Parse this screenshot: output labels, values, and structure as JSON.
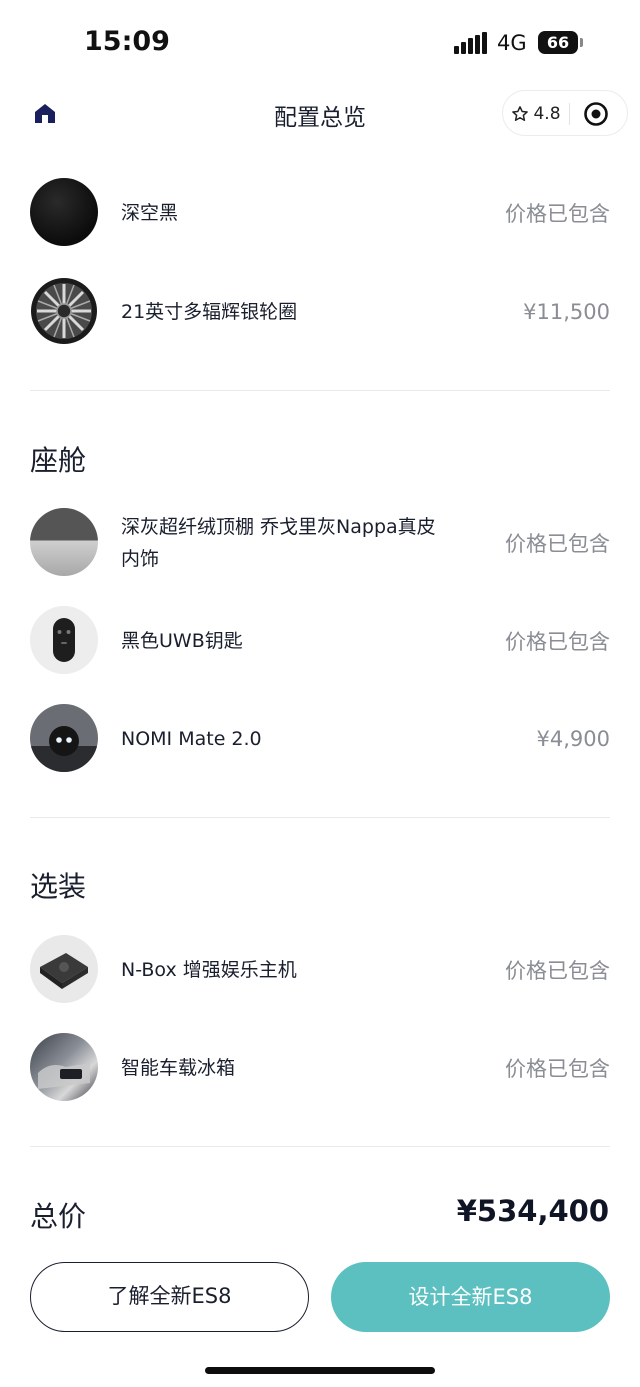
{
  "status_bar": {
    "time": "15:09",
    "network": "4G",
    "battery": "66"
  },
  "nav": {
    "title": "配置总览",
    "rating": "4.8",
    "icons": [
      "home-icon",
      "star-icon",
      "target-icon"
    ]
  },
  "exterior_items": [
    {
      "name": "深空黑",
      "price": "价格已包含",
      "icon": "black-paint-swatch"
    },
    {
      "name": "21英寸多辐辉银轮圈",
      "price": "¥11,500",
      "icon": "wheel-rim"
    }
  ],
  "cabin": {
    "title": "座舱",
    "items": [
      {
        "name": "深灰超纤绒顶棚 乔戈里灰Nappa真皮内饰",
        "price": "价格已包含",
        "icon": "interior-swatch"
      },
      {
        "name": "黑色UWB钥匙",
        "price": "价格已包含",
        "icon": "car-key"
      },
      {
        "name": "NOMI Mate 2.0",
        "price": "¥4,900",
        "icon": "nomi-robot"
      }
    ]
  },
  "options": {
    "title": "选装",
    "items": [
      {
        "name": "N-Box 增强娱乐主机",
        "price": "价格已包含",
        "icon": "nbox-console"
      },
      {
        "name": "智能车载冰箱",
        "price": "价格已包含",
        "icon": "car-fridge"
      }
    ]
  },
  "total": {
    "label": "总价",
    "value": "¥534,400"
  },
  "buttons": {
    "learn": "了解全新ES8",
    "design": "设计全新ES8"
  },
  "colors": {
    "accent": "#5cc0c0",
    "text": "#1a1f2e",
    "muted": "#8a8d94"
  }
}
